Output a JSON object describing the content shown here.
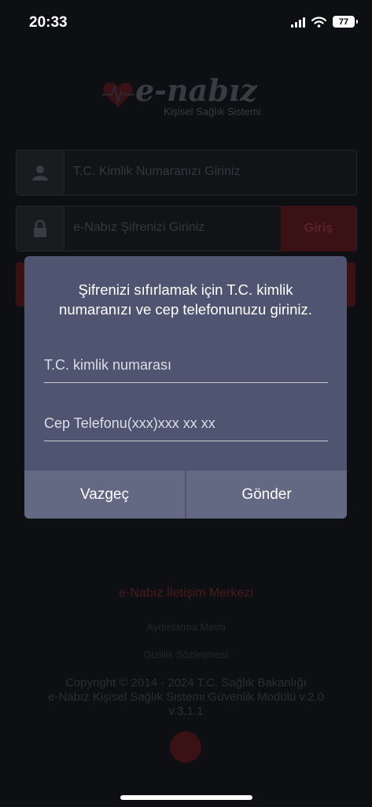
{
  "status_bar": {
    "time": "20:33",
    "battery": "77"
  },
  "app": {
    "logo_text": "e-nabız",
    "logo_subtitle": "Kişisel Sağlık Sistemi",
    "tc_placeholder": "T.C. Kimlik Numaranızı Giriniz",
    "password_placeholder": "e-Nabız Şifrenizi Giriniz",
    "login_label": "Giriş",
    "contact_center": "e-Nabız İletişim Merkezi",
    "clarification_text": "Aydınlatma Metni",
    "privacy_agreement": "Gizlilik Sözleşmesi",
    "copyright_line1": "Copyright © 2014 - 2024 T.C. Sağlık Bakanlığı",
    "copyright_line2": "e-Nabız Kişisel Sağlık Sistemi Güvenlik Modülü v.2.0",
    "version": "v.3.1.1"
  },
  "dialog": {
    "message": "Şifrenizi sıfırlamak için T.C. kimlik numaranızı ve cep telefonunuzu giriniz.",
    "tc_placeholder": "T.C. kimlik numarası",
    "phone_placeholder": "Cep Telefonu(xxx)xxx xx xx",
    "cancel_label": "Vazgeç",
    "send_label": "Gönder"
  },
  "colors": {
    "dialog_bg": "#4f5470",
    "dialog_button_bg": "#636982",
    "brand_red": "#c0392b"
  }
}
